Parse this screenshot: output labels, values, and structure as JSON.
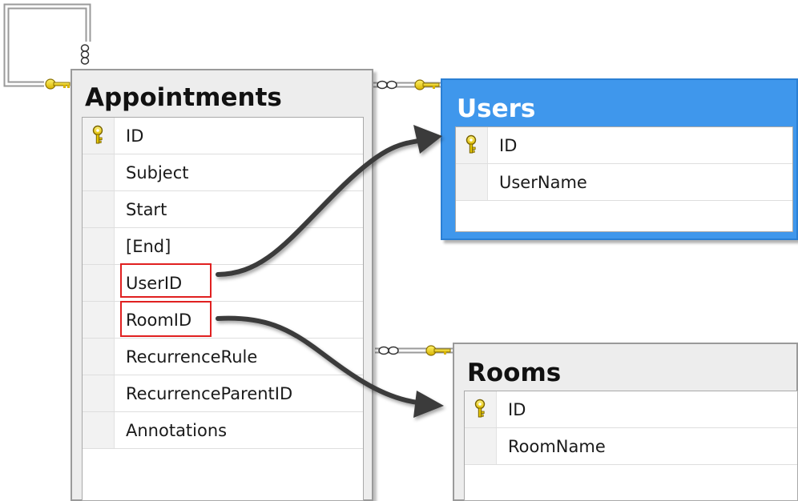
{
  "tables": {
    "appointments": {
      "title": "Appointments",
      "columns": [
        {
          "name": "ID",
          "primary_key": true
        },
        {
          "name": "Subject",
          "primary_key": false
        },
        {
          "name": "Start",
          "primary_key": false
        },
        {
          "name": "[End]",
          "primary_key": false
        },
        {
          "name": "UserID",
          "primary_key": false,
          "highlighted": true
        },
        {
          "name": "RoomID",
          "primary_key": false,
          "highlighted": true
        },
        {
          "name": "RecurrenceRule",
          "primary_key": false
        },
        {
          "name": "RecurrenceParentID",
          "primary_key": false
        },
        {
          "name": "Annotations",
          "primary_key": false
        }
      ]
    },
    "users": {
      "title": "Users",
      "selected": true,
      "columns": [
        {
          "name": "ID",
          "primary_key": true
        },
        {
          "name": "UserName",
          "primary_key": false
        }
      ]
    },
    "rooms": {
      "title": "Rooms",
      "columns": [
        {
          "name": "ID",
          "primary_key": true
        },
        {
          "name": "RoomName",
          "primary_key": false
        }
      ]
    }
  },
  "relationships": [
    {
      "from": "Appointments.UserID",
      "to": "Users.ID"
    },
    {
      "from": "Appointments.RoomID",
      "to": "Rooms.ID"
    },
    {
      "from": "Appointments.RecurrenceParentID",
      "to": "Appointments.ID",
      "self_reference": true
    }
  ],
  "icons": {
    "primary_key": "key-icon",
    "relationship_many_end": "infinity-icon",
    "relationship_one_end": "key-icon"
  },
  "colors": {
    "selected_table": "#3f97ec",
    "table_header": "#ededed",
    "highlight_border": "#e02020",
    "key_icon": "#f0d000",
    "arrow": "#3a3a3a"
  }
}
